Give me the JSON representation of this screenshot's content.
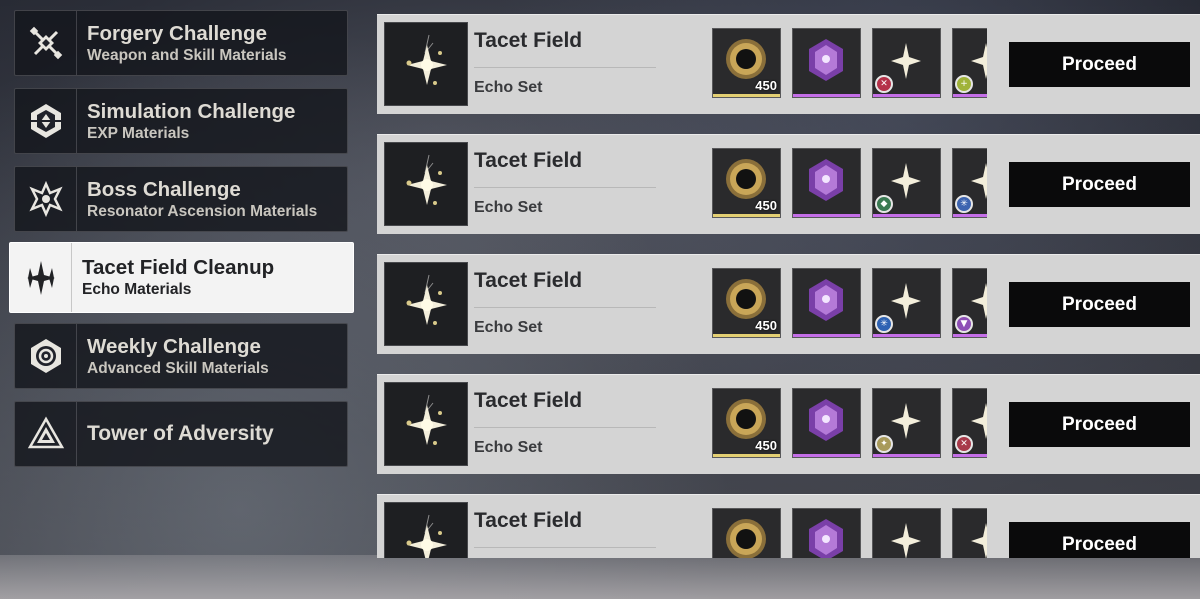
{
  "sidebar": {
    "items": [
      {
        "title": "Forgery Challenge",
        "subtitle": "Weapon and Skill Materials",
        "icon": "forgery-icon"
      },
      {
        "title": "Simulation Challenge",
        "subtitle": "EXP Materials",
        "icon": "simulation-icon"
      },
      {
        "title": "Boss Challenge",
        "subtitle": "Resonator Ascension Materials",
        "icon": "boss-icon"
      },
      {
        "title": "Tacet Field Cleanup",
        "subtitle": "Echo Materials",
        "icon": "tacet-field-icon",
        "active": true
      },
      {
        "title": "Weekly Challenge",
        "subtitle": "Advanced Skill Materials",
        "icon": "weekly-icon"
      },
      {
        "title": "Tower of Adversity",
        "subtitle": "",
        "icon": "tower-icon"
      }
    ]
  },
  "rows": [
    {
      "title": "Tacet Field",
      "subtitle": "Echo Set",
      "reward_qty": "450",
      "button": "Proceed",
      "badges": [
        {
          "icon": "aero-element-icon",
          "color": "#b5324a"
        },
        {
          "icon": "spectro-element-icon",
          "color": "#a0b33a"
        }
      ]
    },
    {
      "title": "Tacet Field",
      "subtitle": "Echo Set",
      "reward_qty": "450",
      "button": "Proceed",
      "badges": [
        {
          "icon": "havoc-element-icon",
          "color": "#3a7a52"
        },
        {
          "icon": "glacio-element-icon",
          "color": "#3d64b0"
        }
      ]
    },
    {
      "title": "Tacet Field",
      "subtitle": "Echo Set",
      "reward_qty": "450",
      "button": "Proceed",
      "badges": [
        {
          "icon": "glacio-element-icon",
          "color": "#2e62b3"
        },
        {
          "icon": "shield-element-icon",
          "color": "#8e4fb6"
        }
      ]
    },
    {
      "title": "Tacet Field",
      "subtitle": "Echo Set",
      "reward_qty": "450",
      "button": "Proceed",
      "badges": [
        {
          "icon": "spectro-element-icon",
          "color": "#a89a5a"
        },
        {
          "icon": "fusion-element-icon",
          "color": "#a83a4a"
        }
      ]
    },
    {
      "title": "Tacet Field",
      "subtitle": "",
      "reward_qty": "",
      "button": "Proceed",
      "badges": []
    }
  ],
  "colors": {
    "gold_rarity": "#e3cf73",
    "purple_rarity": "#c46ee8",
    "button_bg": "#0a0a0b",
    "row_bg": "#d4d4d4",
    "active_nav_bg": "#f3f3f3"
  }
}
